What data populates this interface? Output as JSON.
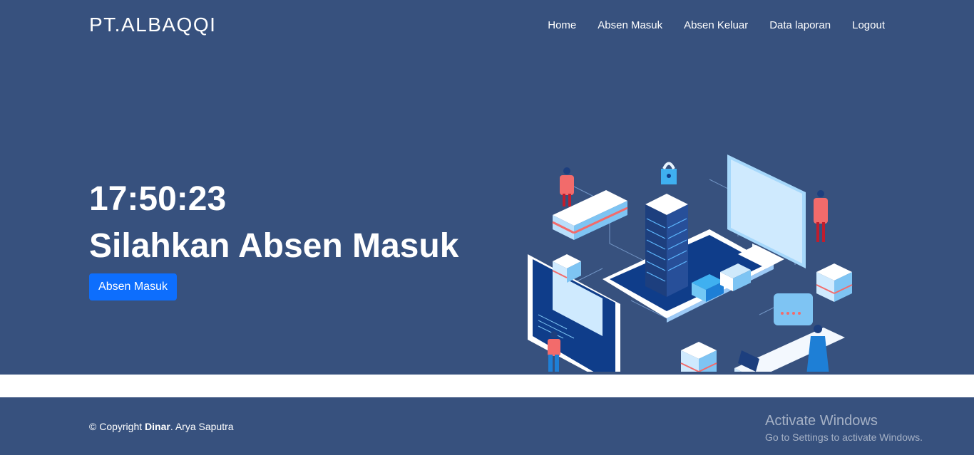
{
  "header": {
    "brand": "PT.ALBAQQI",
    "nav": [
      {
        "label": "Home"
      },
      {
        "label": "Absen Masuk"
      },
      {
        "label": "Absen Keluar"
      },
      {
        "label": "Data laporan"
      },
      {
        "label": "Logout"
      }
    ]
  },
  "hero": {
    "clock": "17:50:23",
    "headline": "Silahkan Absen Masuk",
    "button_label": "Absen Masuk"
  },
  "footer": {
    "copyright_prefix": "© Copyright ",
    "copyright_bold": "Dinar",
    "copyright_suffix": ". Arya Saputra"
  },
  "watermark": {
    "title": "Activate Windows",
    "subtitle": "Go to Settings to activate Windows."
  },
  "colors": {
    "background": "#37517e",
    "button": "#0d6efd",
    "text": "#ffffff"
  }
}
